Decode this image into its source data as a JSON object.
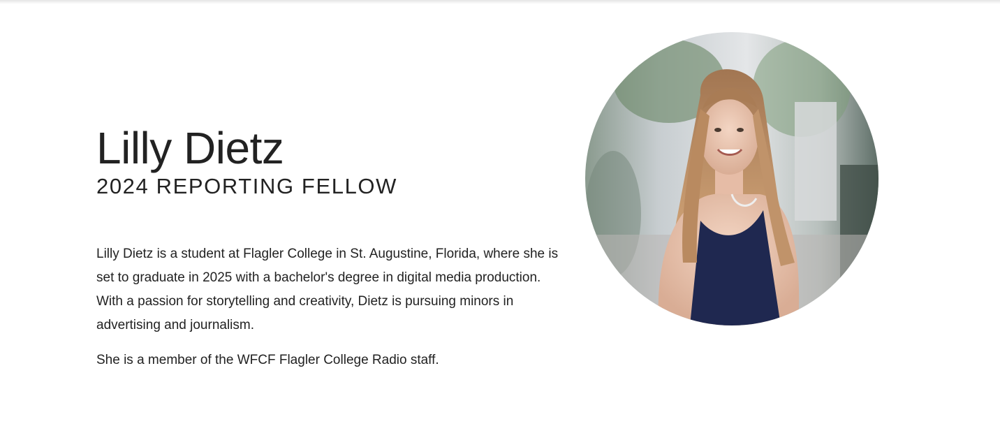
{
  "profile": {
    "name": "Lilly Dietz",
    "role": "2024 REPORTING FELLOW",
    "bio": [
      "Lilly Dietz is a student at Flagler College in St. Augustine, Florida, where she is set to graduate in 2025 with a bachelor's degree in digital media production. With a passion for storytelling and creativity, Dietz is pursuing minors in advertising and journalism.",
      "She is a member of the WFCF Flagler College Radio staff."
    ]
  }
}
